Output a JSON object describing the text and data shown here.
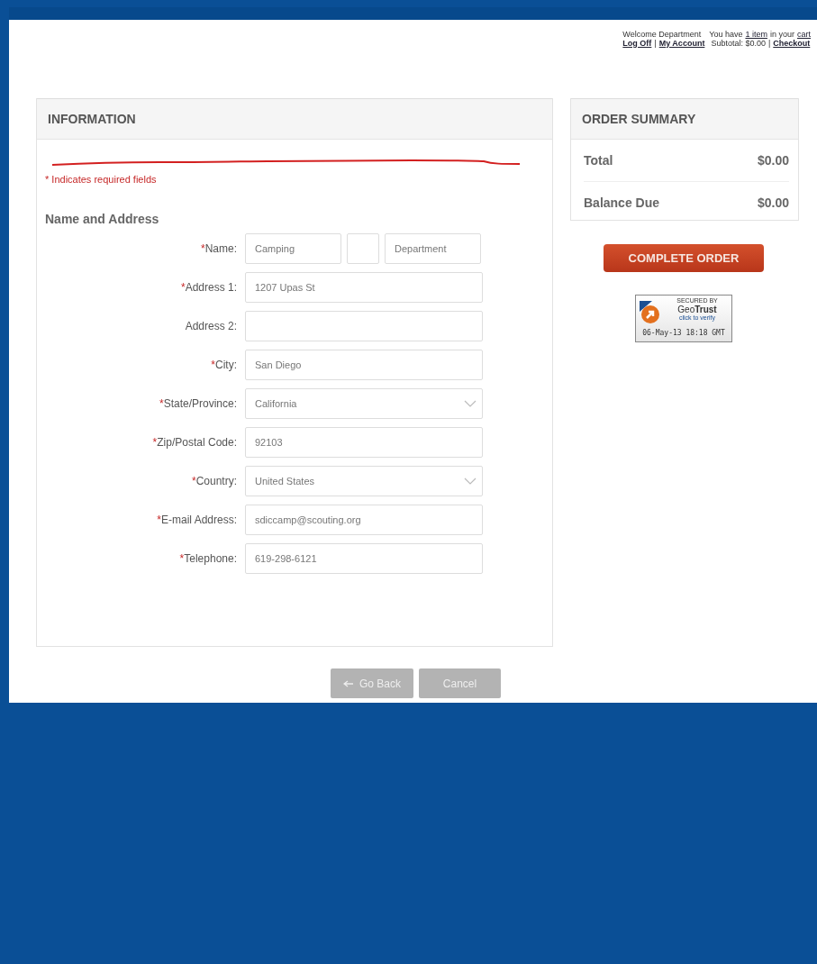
{
  "header": {
    "welcome": "Welcome Department",
    "cart_prefix": "You have",
    "cart_items": "1 item",
    "cart_middle": "in your",
    "cart_link": "cart",
    "logoff": "Log Off",
    "separator": "|",
    "account": "My Account",
    "subtotal": "Subtotal: $0.00",
    "checkout": "Checkout"
  },
  "information": {
    "title": "INFORMATION",
    "required_note": "* Indicates required fields",
    "section": "Name and Address",
    "fields": [
      {
        "kind": "name",
        "mark": "*",
        "label": "Name:",
        "first": "Camping",
        "last": "Department"
      },
      {
        "kind": "text",
        "mark": "*",
        "label": "Address 1:",
        "value": "1207 Upas St"
      },
      {
        "kind": "text",
        "label": "Address 2:"
      },
      {
        "kind": "text",
        "mark": "*",
        "label": "City:",
        "value": "San Diego"
      },
      {
        "kind": "select",
        "mark": "*",
        "label": "State/Province:",
        "value": "California"
      },
      {
        "kind": "text",
        "mark": "*",
        "label": "Zip/Postal Code:",
        "value": "92103"
      },
      {
        "kind": "select",
        "mark": "*",
        "label": "Country:",
        "value": "United States"
      },
      {
        "kind": "text",
        "mark": "*",
        "label": "E-mail Address:",
        "value": "sdiccamp@scouting.org"
      },
      {
        "kind": "text",
        "mark": "*",
        "label": "Telephone:",
        "value": "619-298-6121"
      }
    ]
  },
  "order_summary": {
    "title": "ORDER SUMMARY",
    "rows": [
      {
        "label": "Total",
        "value": "$0.00"
      },
      {
        "label": "Balance Due",
        "value": "$0.00"
      }
    ],
    "button": "COMPLETE ORDER",
    "badge": {
      "top": "SECURED BY",
      "brand_a": "Geo",
      "brand_b": "Trust",
      "action": "click to verify",
      "date": "06-May-13 18:18 GMT"
    }
  },
  "buttons": [
    {
      "kind": "back",
      "label": "Go Back"
    },
    {
      "kind": "plain",
      "label": "Cancel"
    }
  ]
}
